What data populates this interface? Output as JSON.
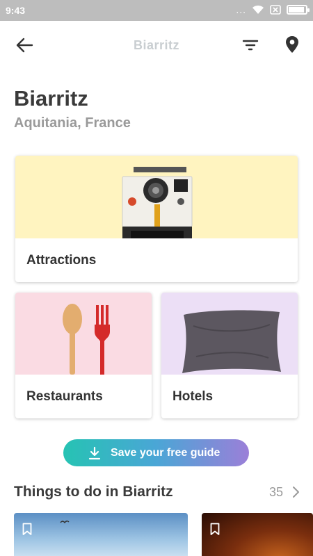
{
  "status_bar": {
    "time": "9:43",
    "dots": "..."
  },
  "header": {
    "title": "Biarritz"
  },
  "place": {
    "name": "Biarritz",
    "region": "Aquitania, France"
  },
  "categories": [
    {
      "label": "Attractions",
      "image": "camera"
    },
    {
      "label": "Restaurants",
      "image": "spoon-and-fork"
    },
    {
      "label": "Hotels",
      "image": "pillow"
    }
  ],
  "guide_button": {
    "label": "Save your free guide"
  },
  "section": {
    "title": "Things to do in Biarritz",
    "count": "35"
  },
  "colors": {
    "status_bar": "#bdbdbd",
    "attractions_bg": "#fff4c0",
    "restaurants_bg": "#fadbe3",
    "hotels_bg": "#ecdff6",
    "gradient_start": "#26c3b3",
    "gradient_end": "#9b7fd8"
  }
}
